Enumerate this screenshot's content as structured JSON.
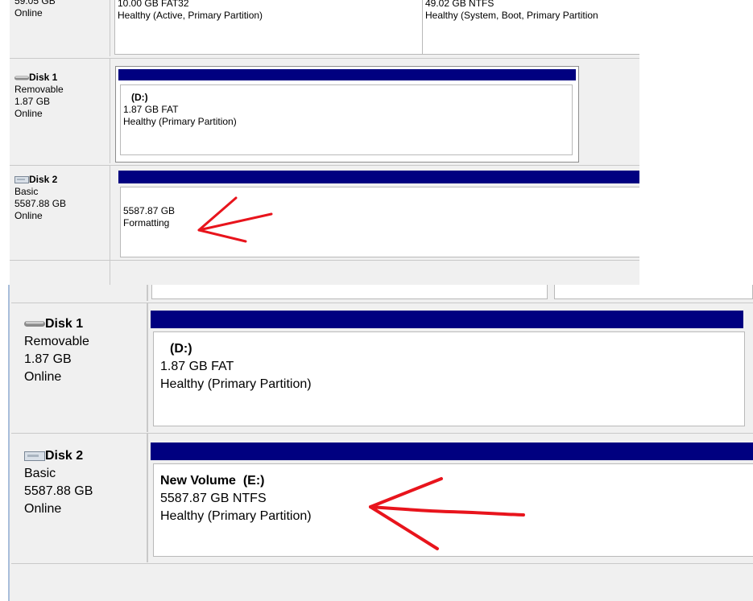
{
  "top_panel": {
    "disk0_partial": {
      "size": "59.05 GB",
      "status": "Online",
      "vol1_size": "10.00 GB FAT32",
      "vol1_health": "Healthy (Active, Primary Partition)",
      "vol2_size": "49.02 GB NTFS",
      "vol2_health": "Healthy (System, Boot, Primary Partition"
    },
    "disk1": {
      "title": "Disk 1",
      "type": "Removable",
      "size": "1.87 GB",
      "status": "Online",
      "vol_name": "(D:)",
      "vol_size": "1.87 GB FAT",
      "vol_health": "Healthy (Primary Partition)"
    },
    "disk2": {
      "title": "Disk 2",
      "type": "Basic",
      "size": "5587.88 GB",
      "status": "Online",
      "vol_size": "5587.87 GB",
      "vol_status": "Formatting"
    }
  },
  "bottom_panel": {
    "disk1": {
      "title": "Disk 1",
      "type": "Removable",
      "size": "1.87 GB",
      "status": "Online",
      "vol_name": "(D:)",
      "vol_size": "1.87 GB FAT",
      "vol_health": "Healthy (Primary Partition)"
    },
    "disk2": {
      "title": "Disk 2",
      "type": "Basic",
      "size": "5587.88 GB",
      "status": "Online",
      "vol_name": "New Volume  (E:)",
      "vol_size": "5587.87 GB NTFS",
      "vol_health": "Healthy (Primary Partition)"
    }
  },
  "colors": {
    "volume_bar": "#000080",
    "annotation_arrow": "#e8141c",
    "panel_bg": "#f0f0f0"
  },
  "icons": [
    "removable-disk-icon",
    "basic-disk-icon"
  ]
}
